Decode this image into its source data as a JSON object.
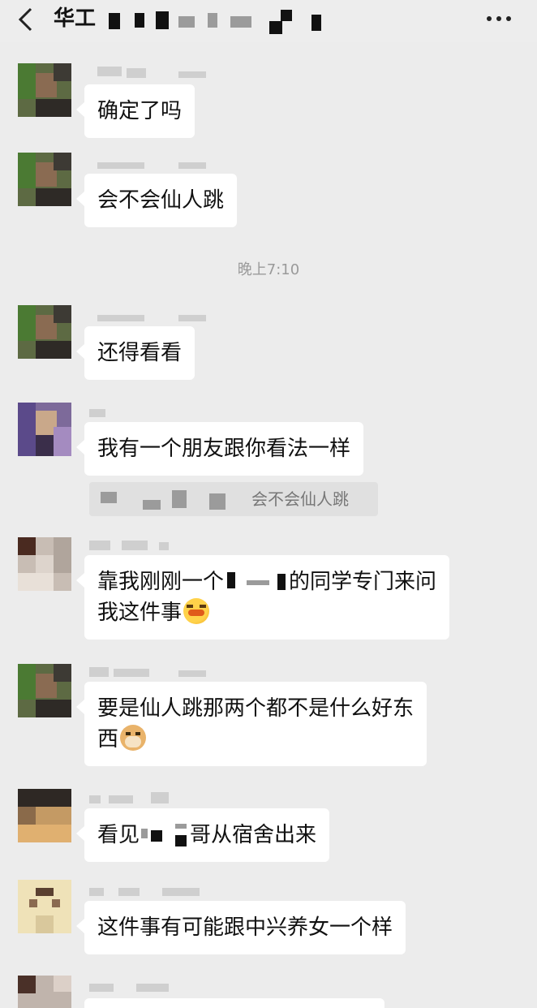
{
  "header": {
    "title": "华工",
    "back_icon": "chevron-left-icon",
    "more_icon": "more-dots-icon"
  },
  "time_divider": "晚上7:10",
  "messages": [
    {
      "text": "确定了吗"
    },
    {
      "text": "会不会仙人跳"
    },
    {
      "text": "还得看看"
    },
    {
      "text": "我有一个朋友跟你看法一样"
    },
    {
      "text_a": "靠我刚刚一个",
      "text_b": "的同学专门来问",
      "text_c": "我这件事",
      "emoji": "facepalm-emoji"
    },
    {
      "text_a": "要是仙人跳那两个都不是什么好东",
      "text_b": "西",
      "emoji": "doge-emoji"
    },
    {
      "text_a": "看见",
      "text_b": "哥从宿舍出来"
    },
    {
      "text": "这件事有可能跟中兴养女一个样"
    }
  ],
  "quote": {
    "text": "会不会仙人跳"
  },
  "colors": {
    "background": "#ececec",
    "bubble": "#ffffff",
    "quote_bg": "#e0e0e0",
    "time_text": "#9a9a9a"
  }
}
